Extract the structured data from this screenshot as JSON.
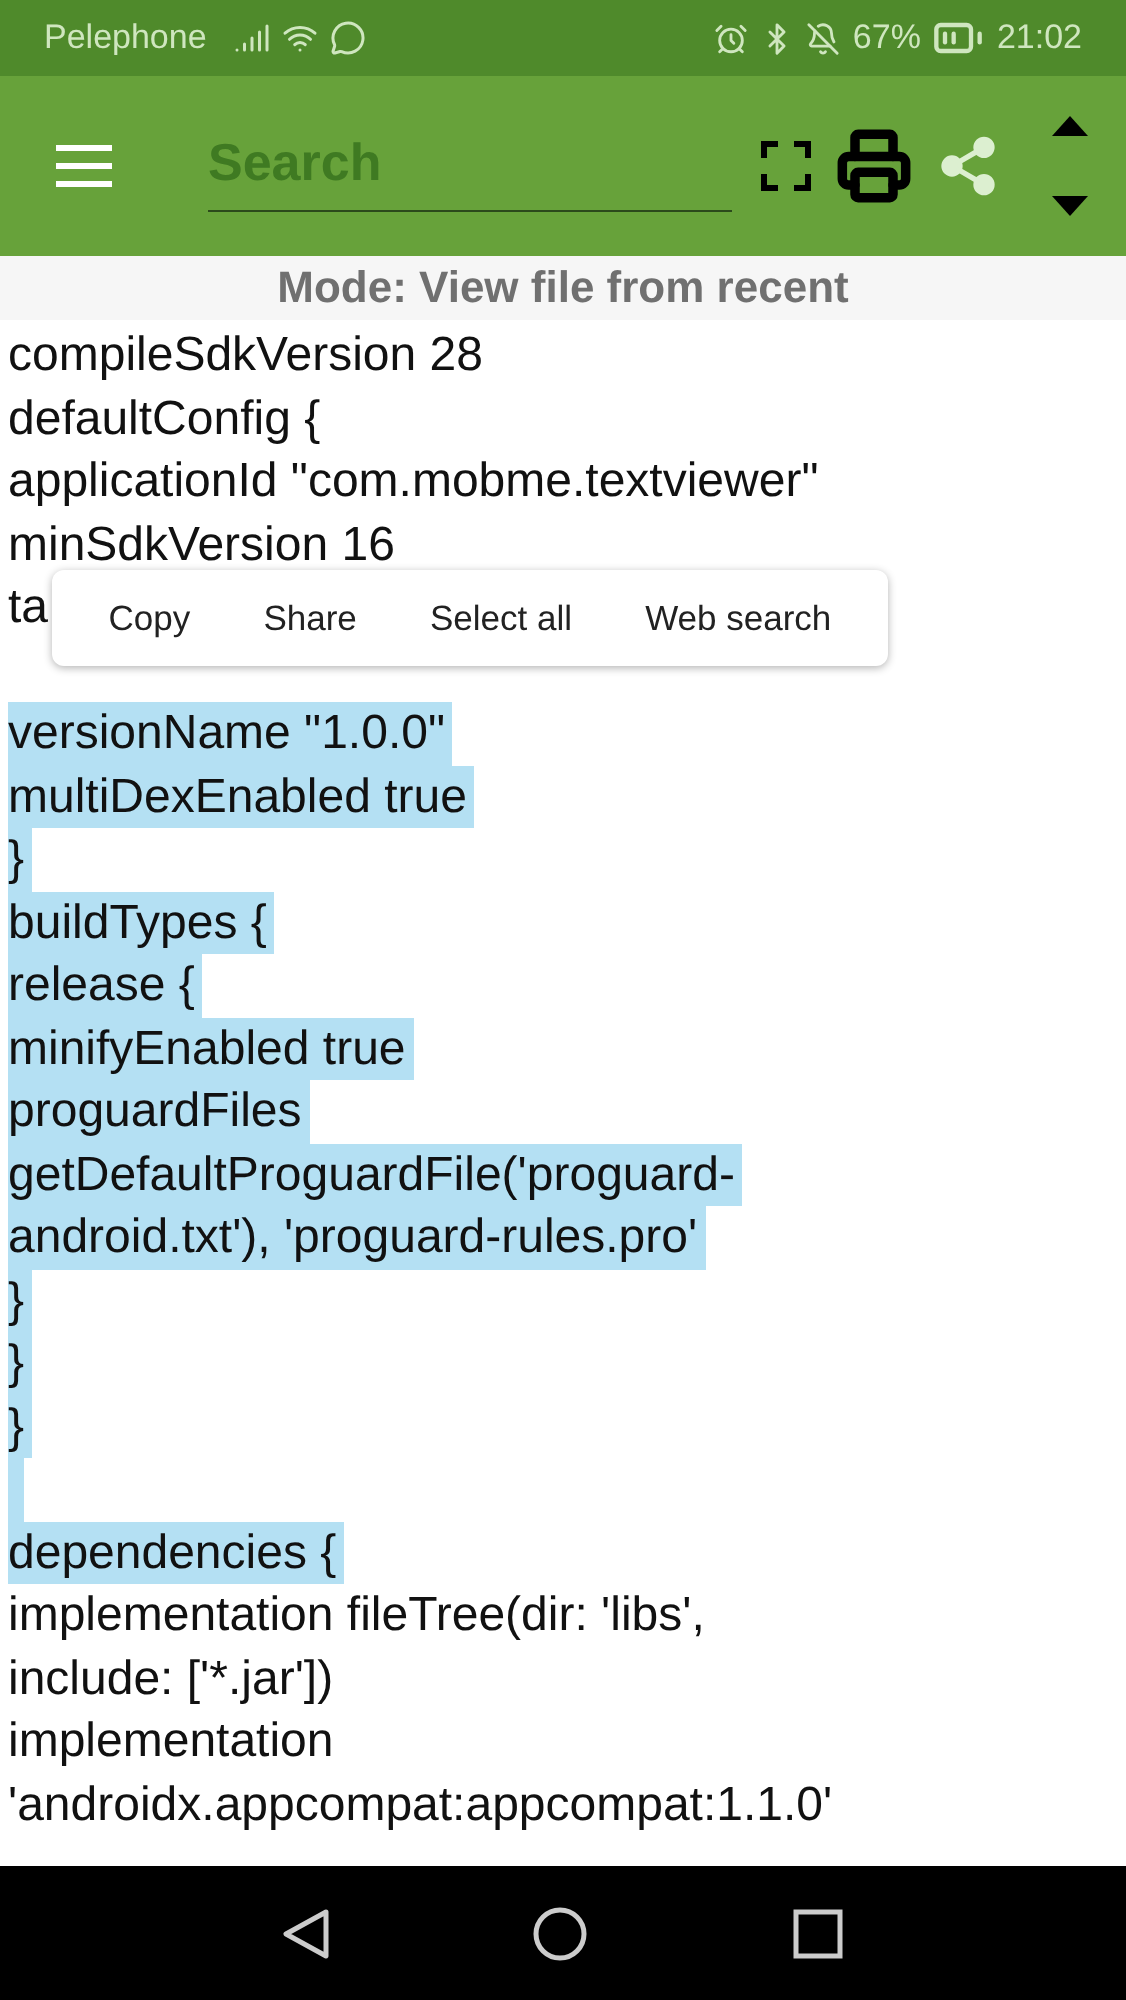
{
  "status_bar": {
    "carrier": "Pelephone",
    "battery": "67%",
    "time": "21:02"
  },
  "toolbar": {
    "search": {
      "placeholder": "Search"
    }
  },
  "mode": "Mode: View file from recent",
  "lines": [
    {
      "kind": "text",
      "text": "compileSdkVersion 28",
      "selected": false
    },
    {
      "kind": "text",
      "text": "defaultConfig {",
      "selected": false
    },
    {
      "kind": "text",
      "text": "applicationId \"com.mobme.textviewer\"",
      "selected": false
    },
    {
      "kind": "text",
      "text": "minSdkVersion 16",
      "selected": false
    },
    {
      "kind": "text",
      "text": "ta",
      "selected": false
    },
    {
      "kind": "spacer"
    },
    {
      "kind": "text",
      "text": "versionName \"1.0.0\"",
      "selected": true
    },
    {
      "kind": "text",
      "text": "multiDexEnabled true",
      "selected": true
    },
    {
      "kind": "text",
      "text": "}",
      "selected": true
    },
    {
      "kind": "text",
      "text": "buildTypes {",
      "selected": true
    },
    {
      "kind": "text",
      "text": "release {",
      "selected": true
    },
    {
      "kind": "text",
      "text": "minifyEnabled true",
      "selected": true
    },
    {
      "kind": "text",
      "text": "proguardFiles",
      "selected": true
    },
    {
      "kind": "text",
      "text": "getDefaultProguardFile('proguard-",
      "selected": true
    },
    {
      "kind": "text",
      "text": "android.txt'), 'proguard-rules.pro'",
      "selected": true
    },
    {
      "kind": "text",
      "text": "}",
      "selected": true
    },
    {
      "kind": "text",
      "text": "}",
      "selected": true
    },
    {
      "kind": "text",
      "text": "}",
      "selected": true
    },
    {
      "kind": "blank",
      "selected": true
    },
    {
      "kind": "text",
      "text": "dependencies {",
      "selected": true
    },
    {
      "kind": "text",
      "text": "implementation fileTree(dir: 'libs',",
      "selected": false
    },
    {
      "kind": "text",
      "text": "include: ['*.jar'])",
      "selected": false
    },
    {
      "kind": "text",
      "text": "implementation",
      "selected": false
    },
    {
      "kind": "text",
      "text": "'androidx.appcompat:appcompat:1.1.0'",
      "selected": false
    }
  ],
  "context_menu": [
    "Copy",
    "Share",
    "Select all",
    "Web search"
  ]
}
